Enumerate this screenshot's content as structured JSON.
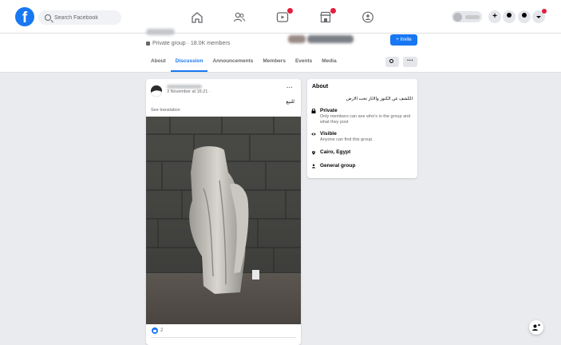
{
  "topbar": {
    "logo_letter": "f",
    "search_placeholder": "Search Facebook",
    "nav_icons": [
      "home-icon",
      "friends-icon",
      "watch-icon",
      "marketplace-icon",
      "groups-icon"
    ],
    "accent_color": "#1877f2",
    "notification_color": "#e41e3f"
  },
  "group": {
    "privacy_text": "Private group · 18.0K members",
    "invite_label": "+ Invite",
    "tabs": [
      "About",
      "Discussion",
      "Announcements",
      "Members",
      "Events",
      "Media"
    ],
    "active_tab": "Discussion",
    "more_label": "···"
  },
  "post": {
    "meta": "3 November at 16:21 · ",
    "more_label": "···",
    "text_arabic": "للبيع",
    "see_translation": "See translation",
    "reaction_count": "2"
  },
  "about": {
    "title": "About",
    "description": "الكشف عن الكنوز والاثار تحت الارض",
    "private_title": "Private",
    "private_desc": "Only members can see who's in the group and what they post",
    "visible_title": "Visible",
    "visible_desc": "Anyone can find this group.",
    "location": "Cairo, Egypt",
    "group_type": "General group"
  }
}
